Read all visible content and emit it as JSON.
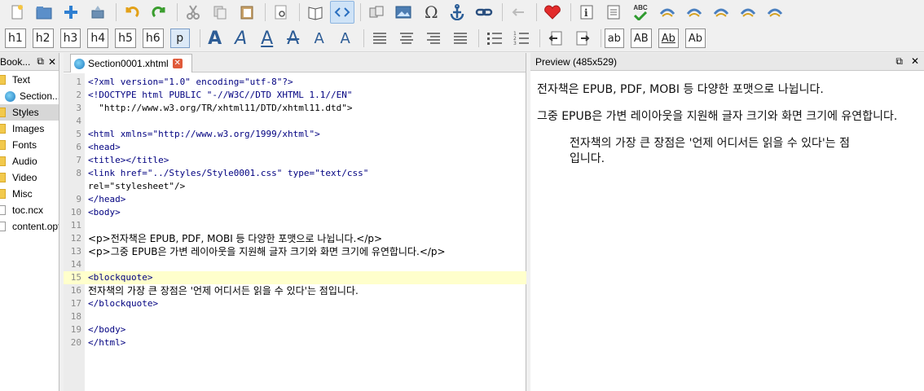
{
  "toolbar_top": {
    "icons": [
      "new-file-icon",
      "open-folder-icon",
      "add-file-icon",
      "save-icon",
      "undo-icon",
      "redo-icon",
      "cut-icon",
      "copy-icon",
      "paste-icon",
      "find-icon",
      "book-view-icon",
      "code-view-icon",
      "split-view-icon",
      "insert-image-icon",
      "insert-special-char-icon",
      "insert-link-icon",
      "insert-anchor-icon",
      "back-icon",
      "donate-heart-icon",
      "meta-editor-icon",
      "toc-editor-icon",
      "spellcheck-icon",
      "validate-icon-1",
      "validate-icon-2",
      "validate-icon-3",
      "validate-icon-4",
      "validate-icon-5"
    ],
    "spellcheck_label": "ABC"
  },
  "toolbar_format": {
    "headings": [
      "h1",
      "h2",
      "h3",
      "h4",
      "h5",
      "h6",
      "p"
    ],
    "active_heading": "p",
    "text_styles": [
      "A",
      "A",
      "A",
      "A",
      "A",
      "A"
    ],
    "case_buttons": [
      "ab",
      "AB",
      "Ab",
      "Ab"
    ]
  },
  "book_browser": {
    "title": "Book...",
    "items": [
      {
        "label": "Text",
        "kind": "folder"
      },
      {
        "label": "Section...",
        "kind": "xhtml"
      },
      {
        "label": "Styles",
        "kind": "folder"
      },
      {
        "label": "Images",
        "kind": "folder"
      },
      {
        "label": "Fonts",
        "kind": "folder"
      },
      {
        "label": "Audio",
        "kind": "folder"
      },
      {
        "label": "Video",
        "kind": "folder"
      },
      {
        "label": "Misc",
        "kind": "folder"
      },
      {
        "label": "toc.ncx",
        "kind": "file"
      },
      {
        "label": "content.opf",
        "kind": "file"
      }
    ]
  },
  "editor": {
    "tab_label": "Section0001.xhtml",
    "lines": [
      {
        "n": "1",
        "text": "<?xml version=\"1.0\" encoding=\"utf-8\"?>"
      },
      {
        "n": "2",
        "text": "<!DOCTYPE html PUBLIC \"-//W3C//DTD XHTML 1.1//EN\""
      },
      {
        "n": "3",
        "text": "  \"http://www.w3.org/TR/xhtml11/DTD/xhtml11.dtd\">"
      },
      {
        "n": "4",
        "text": ""
      },
      {
        "n": "5",
        "text": "<html xmlns=\"http://www.w3.org/1999/xhtml\">"
      },
      {
        "n": "6",
        "text": "<head>"
      },
      {
        "n": "7",
        "text": "<title></title>"
      },
      {
        "n": "8",
        "text": "<link href=\"../Styles/Style0001.css\" type=\"text/css\""
      },
      {
        "n": "",
        "text": "rel=\"stylesheet\"/>"
      },
      {
        "n": "9",
        "text": "</head>"
      },
      {
        "n": "10",
        "text": "<body>"
      },
      {
        "n": "11",
        "text": ""
      },
      {
        "n": "12",
        "text": "<p>전자책은 EPUB, PDF, MOBI 등 다양한 포맷으로 나뉩니다.</p>"
      },
      {
        "n": "13",
        "text": "<p>그중 EPUB은 가변 레이아웃을 지원해 글자 크기와 화면 크기에 유연합니다.</p>"
      },
      {
        "n": "14",
        "text": ""
      },
      {
        "n": "15",
        "text": "<blockquote>"
      },
      {
        "n": "16",
        "text": "전자책의 가장 큰 장점은 '언제 어디서든 읽을 수 있다'는 점입니다."
      },
      {
        "n": "17",
        "text": "</blockquote>"
      },
      {
        "n": "18",
        "text": ""
      },
      {
        "n": "19",
        "text": "</body>"
      },
      {
        "n": "20",
        "text": "</html>"
      }
    ],
    "highlighted_line": "15"
  },
  "preview": {
    "title": "Preview (485x529)",
    "paragraphs": [
      "전자책은 EPUB, PDF, MOBI 등 다양한 포맷으로 나뉩니다.",
      "그중 EPUB은 가변 레이아웃을 지원해 글자 크기와 화면 크기에 유연합니다."
    ],
    "blockquote": "전자책의 가장 큰 장점은 '언제 어디서든 읽을 수 있다'는 점입니다."
  }
}
